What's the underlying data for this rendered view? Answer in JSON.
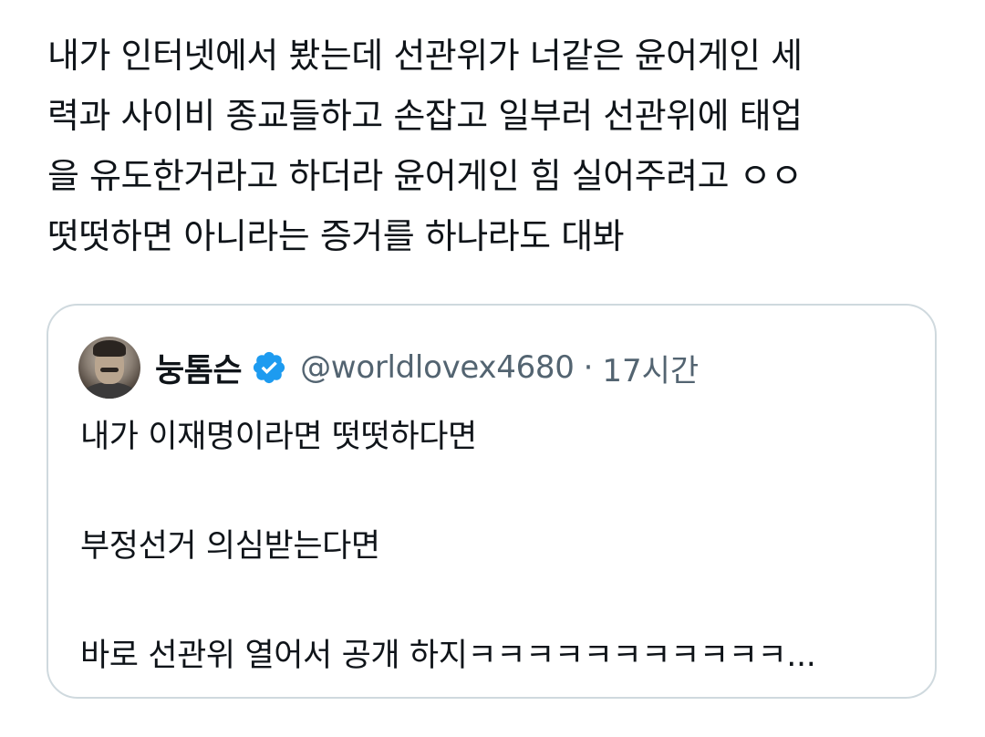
{
  "tweet": {
    "lines": [
      "내가 인터넷에서 봤는데 선관위가 너같은 윤어게인 세",
      "력과 사이비 종교들하고 손잡고 일부러 선관위에 태업",
      "을 유도한거라고 하더라 윤어게인 힘 실어주려고 ㅇㅇ",
      "떳떳하면 아니라는 증거를 하나라도 대봐"
    ]
  },
  "quote": {
    "display_name": "눙톰슨",
    "handle": "@worldlovex4680",
    "separator": "·",
    "time": "17시간",
    "lines": [
      "내가 이재명이라면 떳떳하다면",
      "부정선거 의심받는다면",
      "바로 선관위 열어서 공개 하지ㅋㅋㅋㅋㅋㅋㅋㅋㅋㅋㅋ..."
    ]
  },
  "icons": {
    "verified": "verified-badge-icon",
    "avatar": "user-avatar"
  },
  "colors": {
    "text": "#0f1419",
    "secondary_text": "#536471",
    "border": "#cfd9de",
    "verified_blue": "#1d9bf0"
  }
}
